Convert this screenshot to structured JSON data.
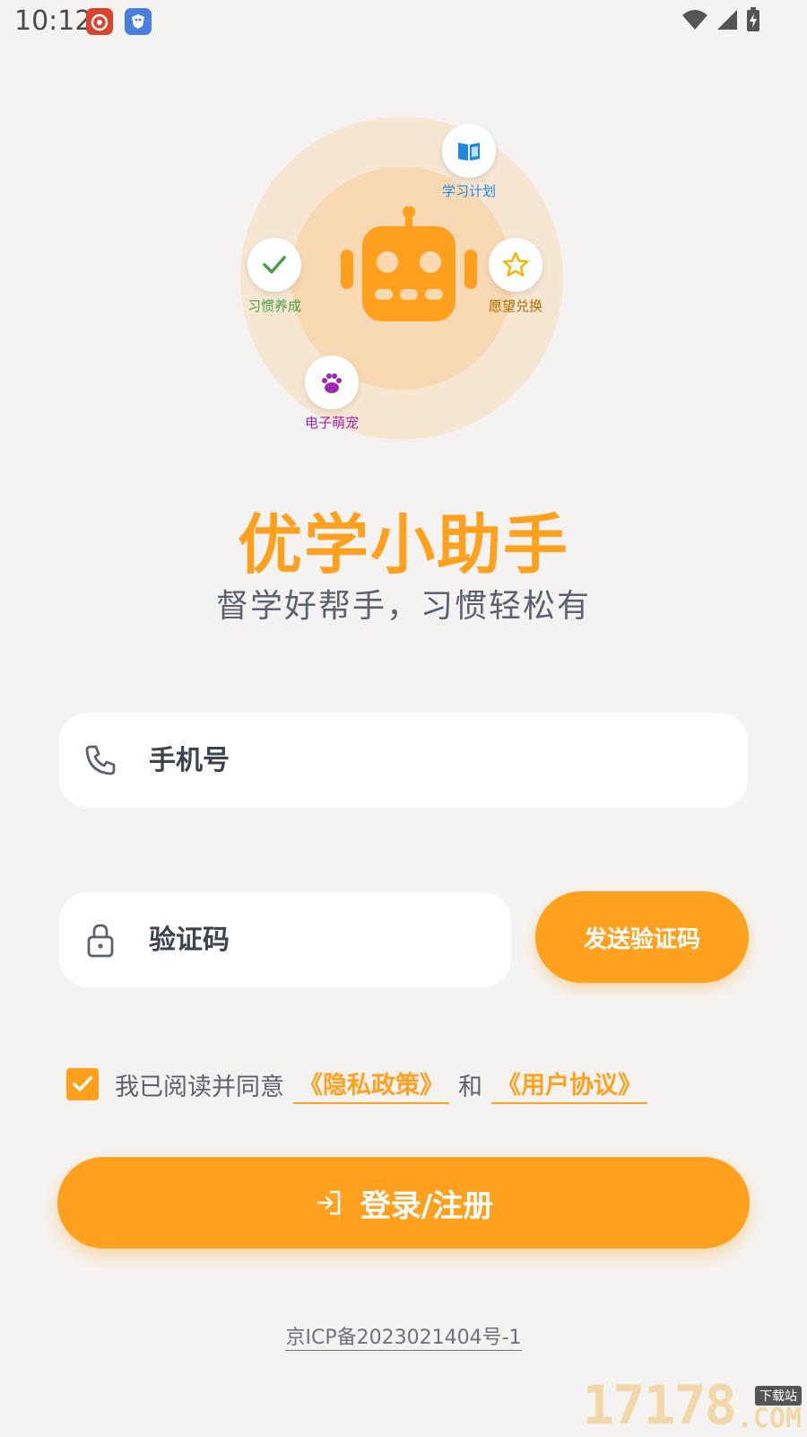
{
  "status_bar": {
    "time": "10:12"
  },
  "hero": {
    "features": [
      {
        "label": "学习计划",
        "icon": "book-icon",
        "color": "#1e88e5"
      },
      {
        "label": "习惯养成",
        "icon": "check-icon",
        "color": "#43a047"
      },
      {
        "label": "愿望兑换",
        "icon": "star-icon",
        "color": "#b26a00"
      },
      {
        "label": "电子萌宠",
        "icon": "paw-icon",
        "color": "#9c27b0"
      }
    ],
    "mascot_icon": "robot-icon"
  },
  "app": {
    "title": "优学小助手",
    "subtitle": "督学好帮手，习惯轻松有"
  },
  "form": {
    "phone_placeholder": "手机号",
    "code_placeholder": "验证码",
    "send_code_label": "发送验证码"
  },
  "agreement": {
    "checked": true,
    "prefix": "我已阅读并同意",
    "privacy_link": "《隐私政策》",
    "conjunction": "和",
    "terms_link": "《用户协议》"
  },
  "login": {
    "label": "登录/注册"
  },
  "footer": {
    "icp": "京ICP备2023021404号-1"
  },
  "watermark": {
    "digits": "17178",
    "tag": "下载站",
    "suffix": ".COM"
  },
  "colors": {
    "accent": "#ffa01f",
    "background": "#f5f3f1",
    "text": "#3d4450"
  }
}
